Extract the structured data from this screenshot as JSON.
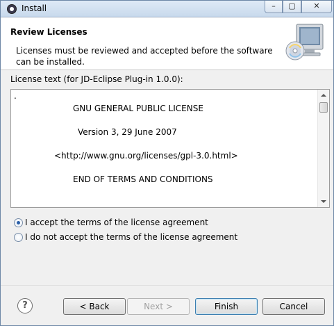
{
  "window": {
    "title": "Install",
    "controls": {
      "minimize": "–",
      "maximize": "▢",
      "close": "✕"
    }
  },
  "header": {
    "title": "Review Licenses",
    "description": "Licenses must be reviewed and accepted before the software can be installed."
  },
  "license": {
    "label": "License text (for JD-Eclipse Plug-in 1.0.0):",
    "leading": ".",
    "lines": [
      "GNU GENERAL PUBLIC LICENSE",
      "Version 3, 29 June 2007",
      "<http://www.gnu.org/licenses/gpl-3.0.html>",
      "END OF TERMS AND CONDITIONS"
    ]
  },
  "options": {
    "accept": {
      "label": "I accept the terms of the license agreement",
      "checked": true
    },
    "decline": {
      "label": "I do not accept the terms of the license agreement",
      "checked": false
    }
  },
  "buttons": {
    "help": "?",
    "back": "< Back",
    "next": "Next >",
    "finish": "Finish",
    "cancel": "Cancel"
  }
}
